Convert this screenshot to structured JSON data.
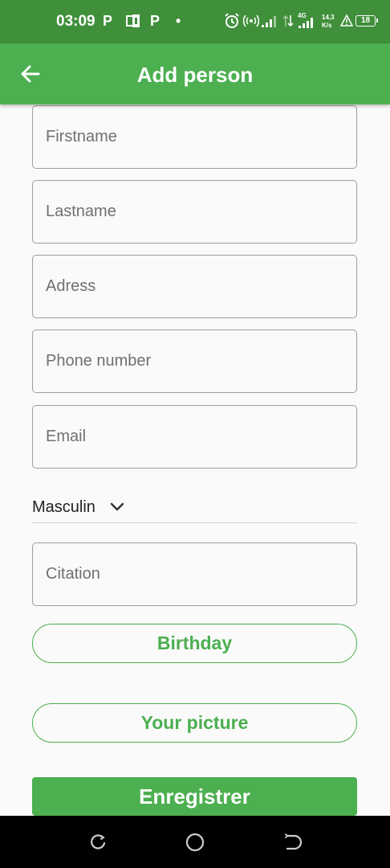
{
  "status_bar": {
    "time": "03:09",
    "app_icons": [
      "P",
      "P"
    ],
    "dot": "•",
    "network_type": "4G",
    "speed_value": "14,3",
    "speed_unit": "K/s",
    "battery": "18"
  },
  "app_bar": {
    "title": "Add person",
    "back_icon": "arrow-left-icon"
  },
  "form": {
    "firstname_placeholder": "Firstname",
    "lastname_placeholder": "Lastname",
    "address_placeholder": "Adress",
    "phone_placeholder": "Phone number",
    "email_placeholder": "Email",
    "gender_selected": "Masculin",
    "citation_placeholder": "Citation",
    "birthday_label": "Birthday",
    "picture_label": "Your picture",
    "save_label": "Enregistrer"
  },
  "colors": {
    "status_bar": "#3f8f3b",
    "primary": "#4caf50",
    "background": "#fafafa",
    "nav_bar": "#000000"
  }
}
